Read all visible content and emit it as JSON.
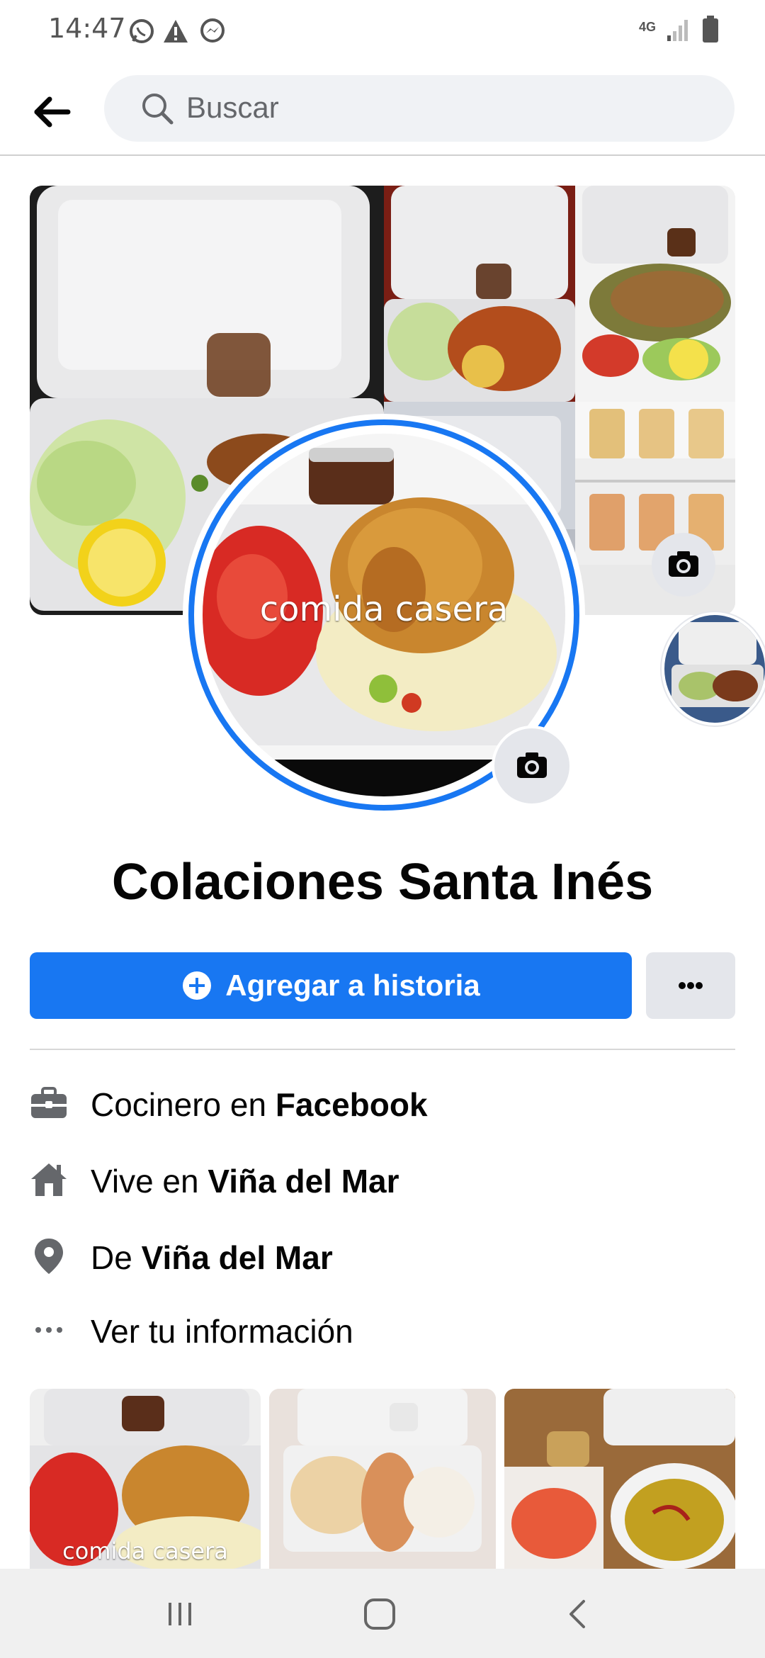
{
  "status": {
    "time": "14:47",
    "network": "4G"
  },
  "search": {
    "placeholder": "Buscar"
  },
  "profile": {
    "name": "Colaciones Santa Inés",
    "avatar_caption": "comida casera"
  },
  "actions": {
    "add_story": "Agregar a historia",
    "more": "···"
  },
  "info": [
    {
      "prefix": "Cocinero en ",
      "bold": "Facebook",
      "icon": "briefcase-icon"
    },
    {
      "prefix": "Vive en ",
      "bold": "Viña del Mar",
      "icon": "home-icon"
    },
    {
      "prefix": "De ",
      "bold": "Viña del Mar",
      "icon": "location-pin-icon"
    },
    {
      "prefix": "Ver tu información",
      "bold": "",
      "icon": "more-dots-icon"
    }
  ],
  "photos": [
    {
      "caption": "comida casera"
    },
    {
      "caption": ""
    },
    {
      "caption": ""
    }
  ],
  "colors": {
    "accent": "#1877f2",
    "button_gray": "#e4e6eb",
    "text_primary": "#050505",
    "text_secondary": "#65676b"
  }
}
